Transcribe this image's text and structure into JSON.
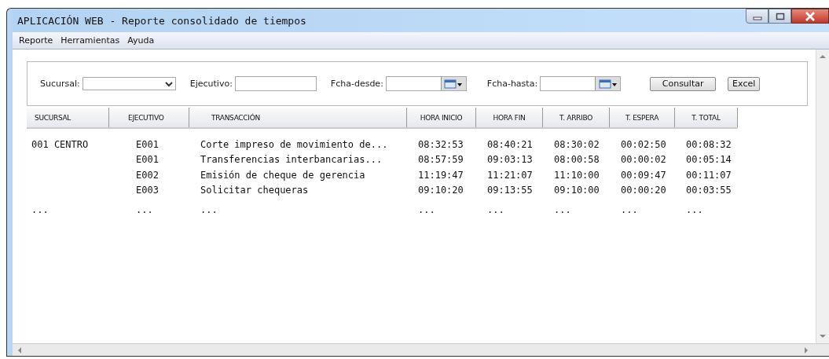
{
  "window": {
    "title": "APLICACIÓN WEB - Reporte consolidado de tiempos"
  },
  "menu": [
    "Reporte",
    "Herramientas",
    "Ayuda"
  ],
  "filters": {
    "sucursal": {
      "label": "Sucursal:"
    },
    "ejecutivo": {
      "label": "Ejecutivo:"
    },
    "fecha_desde": {
      "label": "Fcha-desde:"
    },
    "fecha_hasta": {
      "label": "Fcha-hasta:"
    },
    "buttons": [
      "Consultar",
      "Excel"
    ]
  },
  "table": {
    "columns": [
      "SUCURSAL",
      "EJECUTIVO",
      "TRANSACCIÓN",
      "HORA INICIO",
      "HORA FIN",
      "T. ARRIBO",
      "T. ESPERA",
      "T. TOTAL"
    ],
    "rows": [
      {
        "cells": [
          "001 CENTRO",
          "E001",
          "Corte impreso de movimiento de...",
          "08:32:53",
          "08:40:21",
          "08:30:02",
          "00:02:50",
          "00:08:32"
        ]
      },
      {
        "cells": [
          null,
          "E001",
          "Transferencias interbancarias...",
          "08:57:59",
          "09:03:13",
          "08:00:58",
          "00:00:02",
          "00:05:14"
        ]
      },
      {
        "cells": [
          null,
          "E002",
          "Emisión de cheque de gerencia",
          "11:19:47",
          "11:21:07",
          "11:10:00",
          "00:09:47",
          "00:11:07"
        ]
      },
      {
        "cells": [
          null,
          "E003",
          "Solicitar chequeras",
          "09:10:20",
          "09:13:55",
          "09:10:00",
          "00:00:20",
          "00:03:55"
        ]
      },
      {
        "cells": [
          "...",
          "...",
          "...",
          "...",
          "...",
          "...",
          "...",
          "..."
        ]
      }
    ]
  }
}
